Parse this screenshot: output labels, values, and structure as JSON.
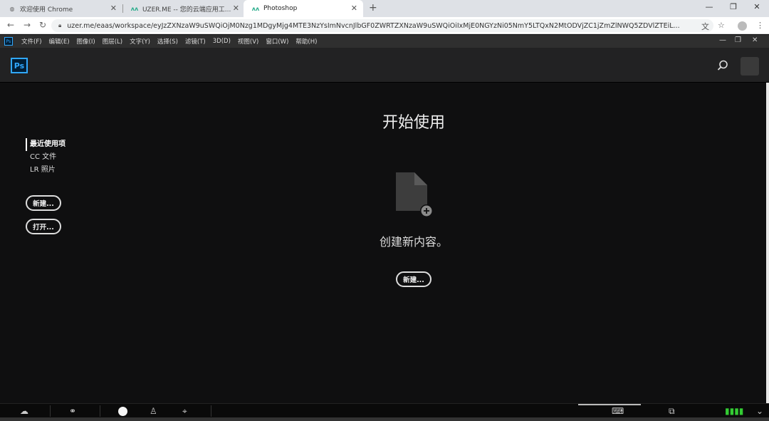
{
  "browser": {
    "tabs": [
      {
        "title": "欢迎使用 Chrome",
        "icon": "globe-icon"
      },
      {
        "title": "UZER.ME -- 您的云端应用工...",
        "icon": "uzer-icon"
      },
      {
        "title": "Photoshop",
        "icon": "uzer-icon"
      }
    ],
    "url": "uzer.me/eaas/workspace/eyJzZXNzaW9uSWQiOjM0Nzg1MDgyMjg4MTE3NzYsImNvcnJlbGF0ZWRTZXNzaW9uSWQiOiIxMjE0NGYzNi05NmY5LTQxN2MtODVjZC1jZmZlNWQ5ZDVlZTEiL..."
  },
  "menubar": {
    "items": [
      "文件(F)",
      "编辑(E)",
      "图像(I)",
      "图层(L)",
      "文字(Y)",
      "选择(S)",
      "滤镜(T)",
      "3D(D)",
      "视图(V)",
      "窗口(W)",
      "帮助(H)"
    ]
  },
  "header": {
    "logo": "Ps"
  },
  "sidebar": {
    "items": [
      "最近使用项",
      "CC 文件",
      "LR 照片"
    ],
    "new_label": "新建...",
    "open_label": "打开..."
  },
  "main": {
    "title": "开始使用",
    "create_text": "创建新内容。",
    "new_label": "新建..."
  }
}
